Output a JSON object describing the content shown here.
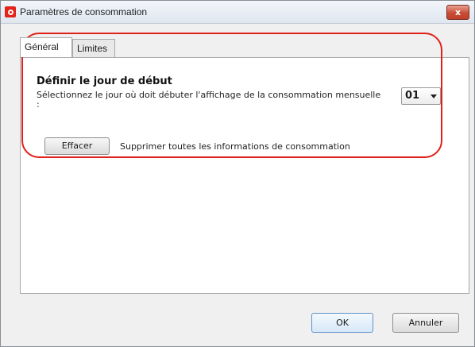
{
  "window": {
    "title": "Paramètres de consommation",
    "close_label": "x",
    "app_icon": "vodafone-logo-icon",
    "close_icon": "close-icon"
  },
  "tabs": [
    {
      "label": "Général",
      "active": true
    },
    {
      "label": "Limites",
      "active": false
    }
  ],
  "general": {
    "section_title": "Définir le jour de début",
    "section_description": "Sélectionnez le jour où doit débuter l'affichage de la consommation mensuelle :",
    "start_day": {
      "value": "01"
    },
    "erase_button_label": "Effacer",
    "erase_description": "Supprimer toutes les informations de consommation"
  },
  "footer": {
    "ok_label": "OK",
    "cancel_label": "Annuler"
  },
  "colors": {
    "highlight": "#e0201c",
    "brand": "#e3231a"
  }
}
